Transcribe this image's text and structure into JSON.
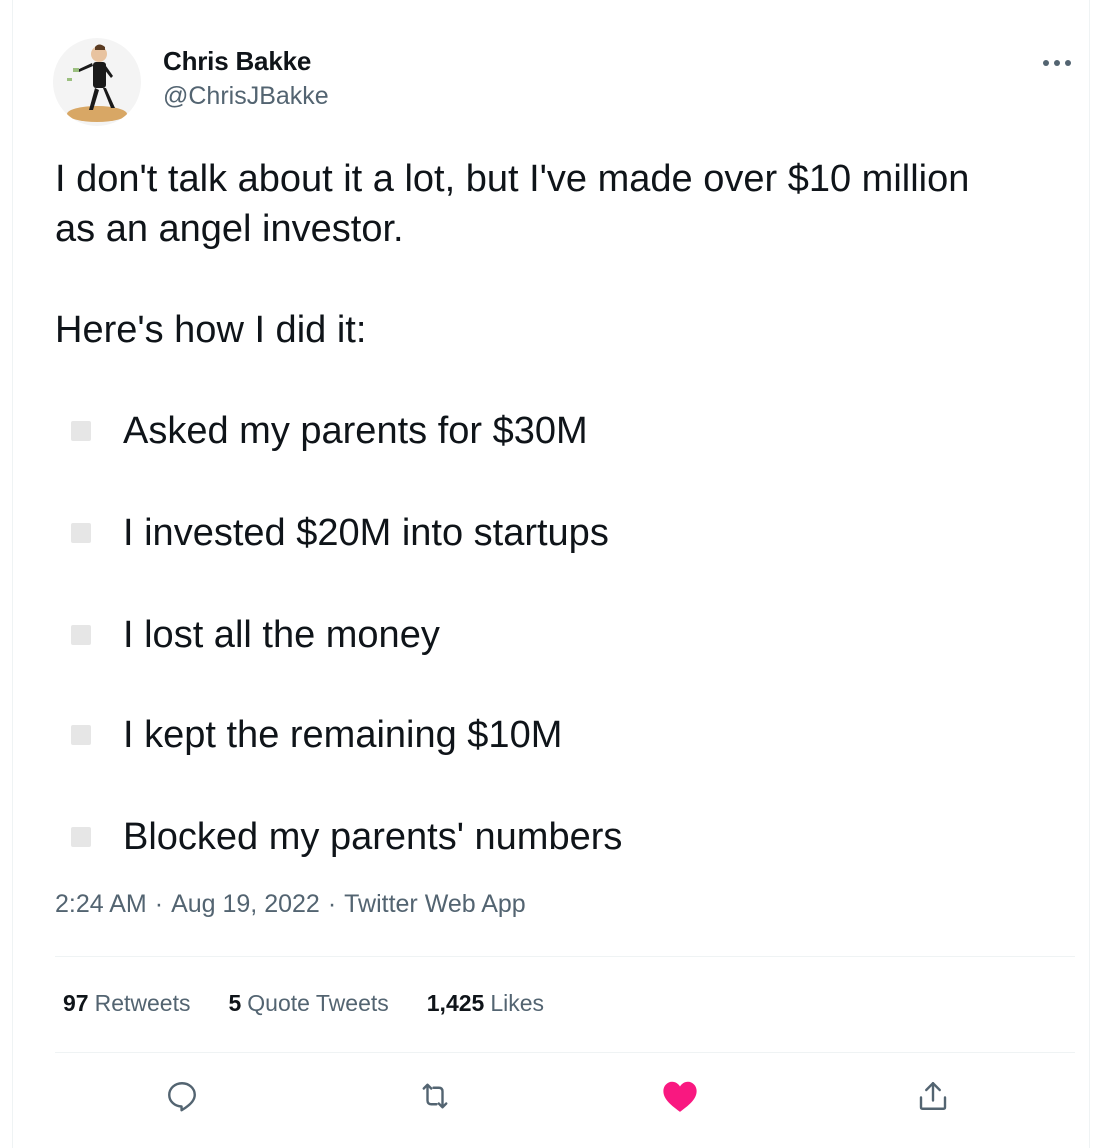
{
  "author": {
    "display_name": "Chris Bakke",
    "handle": "@ChrisJBakke"
  },
  "tweet": {
    "line1": "I don't talk about it a lot, but I've made over $10 million",
    "line2": "as an angel investor.",
    "line3": "Here's how I did it:",
    "list": [
      "Asked my parents for $30M",
      "I invested $20M into startups",
      "I lost all the money",
      "I kept the remaining $10M",
      "Blocked my parents' numbers"
    ]
  },
  "meta": {
    "time": "2:24 AM",
    "separator": "·",
    "date": "Aug 19, 2022",
    "source": "Twitter Web App"
  },
  "stats": {
    "retweets_count": "97",
    "retweets_label": "Retweets",
    "quotes_count": "5",
    "quotes_label": "Quote Tweets",
    "likes_count": "1,425",
    "likes_label": "Likes"
  },
  "actions": {
    "reply_icon": "reply-icon",
    "retweet_icon": "retweet-icon",
    "like_icon": "heart-filled-icon",
    "share_icon": "share-icon",
    "like_color": "#f91880"
  },
  "colors": {
    "text": "#0f1419",
    "secondary": "#536471",
    "divider": "#eff3f4",
    "bullet": "#e6e6e6"
  }
}
